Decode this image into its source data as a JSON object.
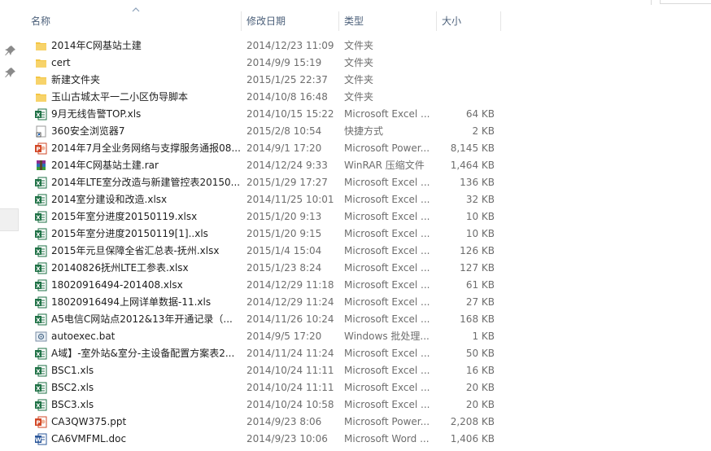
{
  "columns": {
    "name": "名称",
    "date": "修改日期",
    "type": "类型",
    "size": "大小"
  },
  "files": [
    {
      "name": "2014年C网基站土建",
      "date": "2014/12/23 11:09",
      "type": "文件夹",
      "size": "",
      "icon": "folder-icon"
    },
    {
      "name": "cert",
      "date": "2014/9/9 15:19",
      "type": "文件夹",
      "size": "",
      "icon": "folder-icon"
    },
    {
      "name": "新建文件夹",
      "date": "2015/1/25 22:37",
      "type": "文件夹",
      "size": "",
      "icon": "folder-icon"
    },
    {
      "name": "玉山古城太平一二小区伪导脚本",
      "date": "2014/10/8 16:48",
      "type": "文件夹",
      "size": "",
      "icon": "folder-icon"
    },
    {
      "name": "9月无线告警TOP.xls",
      "date": "2014/10/15 15:22",
      "type": "Microsoft Excel ...",
      "size": "64 KB",
      "icon": "excel-icon"
    },
    {
      "name": "360安全浏览器7",
      "date": "2015/2/8 10:54",
      "type": "快捷方式",
      "size": "2 KB",
      "icon": "shortcut-icon"
    },
    {
      "name": "2014年7月全业务网络与支撑服务通报08...",
      "date": "2014/9/1 17:20",
      "type": "Microsoft Power...",
      "size": "8,145 KB",
      "icon": "powerpoint-icon"
    },
    {
      "name": "2014年C网基站土建.rar",
      "date": "2014/12/24 9:33",
      "type": "WinRAR 压缩文件",
      "size": "1,464 KB",
      "icon": "rar-icon"
    },
    {
      "name": "2014年LTE室分改造与新建管控表20150...",
      "date": "2015/1/29 17:27",
      "type": "Microsoft Excel ...",
      "size": "136 KB",
      "icon": "excel-icon"
    },
    {
      "name": "2014室分建设和改造.xlsx",
      "date": "2014/11/25 10:01",
      "type": "Microsoft Excel ...",
      "size": "32 KB",
      "icon": "excel-icon"
    },
    {
      "name": "2015年室分进度20150119.xlsx",
      "date": "2015/1/20 9:13",
      "type": "Microsoft Excel ...",
      "size": "10 KB",
      "icon": "excel-icon"
    },
    {
      "name": "2015年室分进度20150119[1]..xls",
      "date": "2015/1/20 9:15",
      "type": "Microsoft Excel ...",
      "size": "10 KB",
      "icon": "excel-icon"
    },
    {
      "name": "2015年元旦保障全省汇总表-抚州.xlsx",
      "date": "2015/1/4 15:04",
      "type": "Microsoft Excel ...",
      "size": "126 KB",
      "icon": "excel-icon"
    },
    {
      "name": "20140826抚州LTE工参表.xlsx",
      "date": "2015/1/23 8:24",
      "type": "Microsoft Excel ...",
      "size": "127 KB",
      "icon": "excel-icon"
    },
    {
      "name": "18020916494-201408.xlsx",
      "date": "2014/12/29 11:18",
      "type": "Microsoft Excel ...",
      "size": "61 KB",
      "icon": "excel-icon"
    },
    {
      "name": "18020916494上网详单数据-11.xls",
      "date": "2014/12/29 11:24",
      "type": "Microsoft Excel ...",
      "size": "27 KB",
      "icon": "excel-icon"
    },
    {
      "name": "A5电信C网站点2012&13年开通记录（...",
      "date": "2014/11/26 10:24",
      "type": "Microsoft Excel ...",
      "size": "168 KB",
      "icon": "excel-icon"
    },
    {
      "name": "autoexec.bat",
      "date": "2014/9/5 17:20",
      "type": "Windows 批处理...",
      "size": "1 KB",
      "icon": "batch-icon"
    },
    {
      "name": "A域】-室外站&室分-主设备配置方案表2...",
      "date": "2014/11/24 11:24",
      "type": "Microsoft Excel ...",
      "size": "50 KB",
      "icon": "excel-icon"
    },
    {
      "name": "BSC1.xls",
      "date": "2014/10/24 11:11",
      "type": "Microsoft Excel ...",
      "size": "16 KB",
      "icon": "excel-icon"
    },
    {
      "name": "BSC2.xls",
      "date": "2014/10/24 11:11",
      "type": "Microsoft Excel ...",
      "size": "20 KB",
      "icon": "excel-icon"
    },
    {
      "name": "BSC3.xls",
      "date": "2014/10/24 10:58",
      "type": "Microsoft Excel ...",
      "size": "20 KB",
      "icon": "excel-icon"
    },
    {
      "name": "CA3QW375.ppt",
      "date": "2014/9/23 8:06",
      "type": "Microsoft Power...",
      "size": "2,208 KB",
      "icon": "powerpoint-icon"
    },
    {
      "name": "CA6VMFML.doc",
      "date": "2014/9/23 10:06",
      "type": "Microsoft Word ...",
      "size": "1,406 KB",
      "icon": "word-icon"
    }
  ],
  "colors": {
    "folder": "#f4c542",
    "excel": "#1e7145",
    "powerpoint": "#d24726",
    "word": "#2b579a",
    "header_text": "#4c607a"
  }
}
